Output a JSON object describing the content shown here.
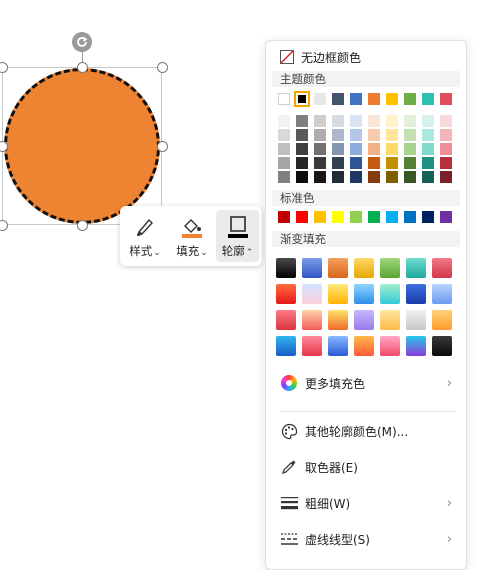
{
  "shape": {
    "fill_color": "#ee8331",
    "outline": "dashed",
    "outline_color": "#111111"
  },
  "float_toolbar": {
    "style_label": "样式",
    "fill_label": "填充",
    "outline_label": "轮廓",
    "caret_down": "⌄",
    "caret_up": "⌃",
    "active": "outline"
  },
  "panel": {
    "no_border_label": "无边框颜色",
    "theme_colors_header": "主题颜色",
    "theme_top_row": [
      "#ffffff",
      "#000000",
      "#e7e6e6",
      "#44546a",
      "#4472c4",
      "#ed7d31",
      "#ffc000",
      "#70ad47",
      "#2cc0b0",
      "#e04e5c"
    ],
    "theme_selected_index": 1,
    "theme_shades": [
      [
        "#f2f2f2",
        "#7f7f7f",
        "#d0cece",
        "#d6dce4",
        "#d9e2f3",
        "#fbe5d6",
        "#fff2cc",
        "#e2efd9",
        "#d4f3ef",
        "#f9d9dc"
      ],
      [
        "#d9d9d9",
        "#595959",
        "#aeabab",
        "#adb9ca",
        "#b4c6e7",
        "#f8cbad",
        "#ffe699",
        "#c5e0b3",
        "#aae7df",
        "#f3b4ba"
      ],
      [
        "#bfbfbf",
        "#3f3f3f",
        "#757171",
        "#8497b0",
        "#8faadc",
        "#f4b183",
        "#ffd966",
        "#a9d18e",
        "#80dbcf",
        "#ed8e98"
      ],
      [
        "#a6a6a6",
        "#262626",
        "#3a3838",
        "#333f50",
        "#2f5597",
        "#c55a11",
        "#bf9000",
        "#548235",
        "#1f9084",
        "#b9303d"
      ],
      [
        "#808080",
        "#0d0d0d",
        "#171616",
        "#222a35",
        "#203864",
        "#843c0c",
        "#7f6000",
        "#375623",
        "#156058",
        "#7b2029"
      ]
    ],
    "standard_header": "标准色",
    "standard_colors": [
      "#c00000",
      "#ff0000",
      "#ffc000",
      "#ffff00",
      "#92d050",
      "#00b050",
      "#00b0f0",
      "#0070c0",
      "#002060",
      "#7030a0"
    ],
    "gradient_header": "渐变填充",
    "gradients": [
      [
        "linear-gradient(#4a4a4a,#000)",
        "linear-gradient(#7b9be8,#2e57c4)",
        "linear-gradient(#f5a05e,#d8661a)",
        "linear-gradient(#ffd86a,#e4a800)",
        "linear-gradient(#9fd77a,#5aa532)",
        "linear-gradient(#6fdbd0,#1fa899)",
        "linear-gradient(#f27a86,#d2364a)"
      ],
      [
        "linear-gradient(#ff6d3a,#e8161a)",
        "linear-gradient(#cfe4ff,#ffd0dc)",
        "linear-gradient(#ffe97a,#ffb200)",
        "linear-gradient(#8fd4ff,#2d8fe8)",
        "linear-gradient(#9ef0c8,#36c8d8)",
        "linear-gradient(#3e6fe0,#1a3aa8)",
        "linear-gradient(#b8d2ff,#6a9cf0)"
      ],
      [
        "linear-gradient(#ff7a86,#d8363e)",
        "linear-gradient(#ffd4a8,#f25a5a)",
        "linear-gradient(#ffe36a,#f06a2a)",
        "linear-gradient(#c8b8ff,#9a7ae8)",
        "linear-gradient(#ffe7a0,#ffb94a)",
        "linear-gradient(#f0f0f0,#c8c8c8)",
        "linear-gradient(#ffd27a,#ff9a2a)"
      ],
      [
        "linear-gradient(#2fb8f0,#1a5ac8)",
        "linear-gradient(#ff8a9a,#e8364a)",
        "linear-gradient(#8ab8ff,#2a5ad8)",
        "linear-gradient(#ffb84a,#ff5a3a)",
        "linear-gradient(#ffa8c8,#f04a6a)",
        "linear-gradient(#2ac8e8,#8a3ad8)",
        "linear-gradient(#3a3a3a,#0a0a0a)"
      ]
    ],
    "more_fill_label": "更多填充色",
    "other_outline_label": "其他轮廓颜色(M)...",
    "eyedropper_label": "取色器(E)",
    "weight_label": "粗细(W)",
    "dash_label": "虚线线型(S)",
    "chevron": "›"
  }
}
